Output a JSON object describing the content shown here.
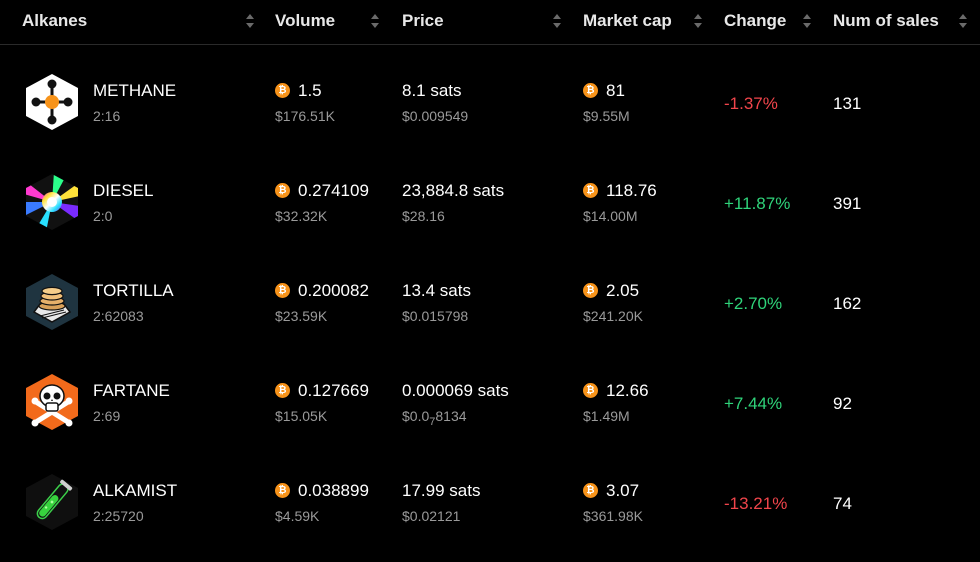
{
  "columns": [
    {
      "label": "Alkanes"
    },
    {
      "label": "Volume"
    },
    {
      "label": "Price"
    },
    {
      "label": "Market cap"
    },
    {
      "label": "Change"
    },
    {
      "label": "Num of sales"
    }
  ],
  "rows": [
    {
      "name": "METHANE",
      "id": "2:16",
      "volume": "1.5",
      "volume_usd": "$176.51K",
      "price": "8.1 sats",
      "price_usd": "$0.009549",
      "mcap": "81",
      "mcap_usd": "$9.55M",
      "change": "-1.37%",
      "change_dir": "neg",
      "sales": "131",
      "icon": "methane-molecule-icon"
    },
    {
      "name": "DIESEL",
      "id": "2:0",
      "volume": "0.274109",
      "volume_usd": "$32.32K",
      "price": "23,884.8 sats",
      "price_usd": "$28.16",
      "mcap": "118.76",
      "mcap_usd": "$14.00M",
      "change": "+11.87%",
      "change_dir": "pos",
      "sales": "391",
      "icon": "diesel-rainbow-icon"
    },
    {
      "name": "TORTILLA",
      "id": "2:62083",
      "volume": "0.200082",
      "volume_usd": "$23.59K",
      "price": "13.4 sats",
      "price_usd": "$0.015798",
      "mcap": "2.05",
      "mcap_usd": "$241.20K",
      "change": "+2.70%",
      "change_dir": "pos",
      "sales": "162",
      "icon": "tortilla-stack-icon"
    },
    {
      "name": "FARTANE",
      "id": "2:69",
      "volume": "0.127669",
      "volume_usd": "$15.05K",
      "price": "0.000069 sats",
      "price_usd": "$0.0",
      "price_usd_sub": "7",
      "price_usd_tail": "8134",
      "mcap": "12.66",
      "mcap_usd": "$1.49M",
      "change": "+7.44%",
      "change_dir": "pos",
      "sales": "92",
      "icon": "skull-crossbones-icon"
    },
    {
      "name": "ALKAMIST",
      "id": "2:25720",
      "volume": "0.038899",
      "volume_usd": "$4.59K",
      "price": "17.99 sats",
      "price_usd": "$0.02121",
      "mcap": "3.07",
      "mcap_usd": "$361.98K",
      "change": "-13.21%",
      "change_dir": "neg",
      "sales": "74",
      "icon": "test-tube-icon"
    }
  ],
  "colors": {
    "bitcoin": "#f7931a",
    "negative": "#f0454b",
    "positive": "#2fd37a"
  }
}
